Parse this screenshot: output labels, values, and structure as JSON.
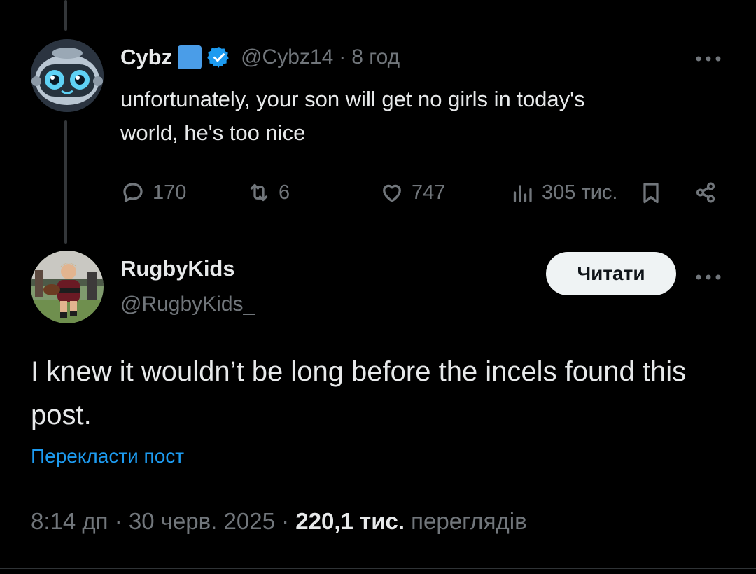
{
  "parent_post": {
    "display_name": "Cybz",
    "handle": "@Cybz14",
    "separator": "·",
    "time": "8 год",
    "text_line1": "unfortunately, your son will get no girls in today's",
    "text_line2": "world, he's too nice",
    "reply_count": "170",
    "repost_count": "6",
    "like_count": "747",
    "view_count": "305 тис.",
    "more_icon": "ellipsis-icon",
    "avatar_desc": "robot-avatar"
  },
  "main_post": {
    "display_name": "RugbyKids",
    "handle": "@RugbyKids_",
    "follow_label": "Читати",
    "text": "I knew it wouldn’t be long before the incels found this post.",
    "translate_label": "Перекласти пост",
    "time": "8:14 дп",
    "date": "30 черв. 2025",
    "separator": "·",
    "views_value": "220,1 тис.",
    "views_label": "переглядів"
  },
  "colors": {
    "background": "#000000",
    "text": "#e7e9ea",
    "muted": "#71767b",
    "link": "#1d9bf0",
    "verified": "#1d9bf0",
    "square_emoji": "#4a9de8",
    "follow_button_bg": "#eff3f4"
  }
}
